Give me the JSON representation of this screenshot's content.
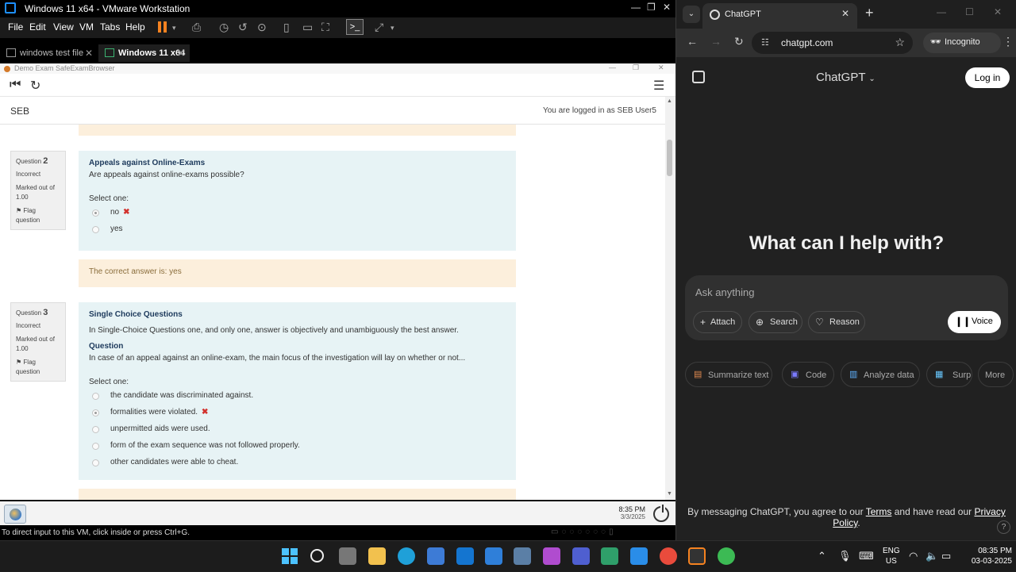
{
  "vmware": {
    "title": "Windows 11 x64 - VMware Workstation",
    "menu": [
      "File",
      "Edit",
      "View",
      "VM",
      "Tabs",
      "Help"
    ],
    "tabs": [
      {
        "label": "windows test file",
        "active": false
      },
      {
        "label": "Windows 11 x64",
        "active": true
      }
    ],
    "status_text": "To direct input to this VM, click inside or press Ctrl+G."
  },
  "seb": {
    "window_title": "Demo Exam SafeExamBrowser",
    "brand": "SEB",
    "login_text": "You are logged in as SEB User5",
    "questions": [
      {
        "label": "Question",
        "number": "2",
        "state": "Incorrect",
        "marks": "Marked out of 1.00",
        "flag": "Flag question",
        "title": "Appeals against Online-Exams",
        "text": "Are appeals against online-exams possible?",
        "select_label": "Select one:",
        "options": [
          {
            "label": "no",
            "selected": true,
            "wrong": true
          },
          {
            "label": "yes",
            "selected": false,
            "wrong": false
          }
        ],
        "feedback": "The correct answer is: yes"
      },
      {
        "label": "Question",
        "number": "3",
        "state": "Incorrect",
        "marks": "Marked out of 1.00",
        "flag": "Flag question",
        "title": "Single Choice Questions",
        "text": "In Single-Choice Questions one, and only one, answer is objectively and unambiguously the best answer.",
        "subheading": "Question",
        "subtext": "In case of an appeal against an online-exam, the main focus of the investigation will lay on whether or not...",
        "select_label": "Select one:",
        "options": [
          {
            "label": "the candidate was discriminated against.",
            "selected": false,
            "wrong": false
          },
          {
            "label": "formalities were violated.",
            "selected": true,
            "wrong": true
          },
          {
            "label": "unpermitted aids were used.",
            "selected": false,
            "wrong": false
          },
          {
            "label": "form of the exam sequence was not followed properly.",
            "selected": false,
            "wrong": false
          },
          {
            "label": "other candidates were able to cheat.",
            "selected": false,
            "wrong": false
          }
        ]
      }
    ],
    "guest_clock": {
      "time": "8:35 PM",
      "date": "3/3/2025"
    }
  },
  "chrome": {
    "tab_title": "ChatGPT",
    "url": "chatgpt.com",
    "incognito_label": "Incognito"
  },
  "chatgpt": {
    "model": "ChatGPT",
    "login": "Log in",
    "hero": "What can I help with?",
    "placeholder": "Ask anything",
    "actions": [
      "Attach",
      "Search",
      "Reason"
    ],
    "voice": "Voice",
    "chips": [
      "Summarize text",
      "Code",
      "Analyze data",
      "Surp",
      "More"
    ],
    "terms_prefix": "By messaging ChatGPT, you agree to our ",
    "terms_link": "Terms",
    "terms_mid": " and have read our ",
    "privacy_link": "Privacy Policy",
    "terms_suffix": ".",
    "help": "?"
  },
  "taskbar": {
    "lang": "ENG",
    "region": "US",
    "time": "08:35 PM",
    "date": "03-03-2025"
  }
}
